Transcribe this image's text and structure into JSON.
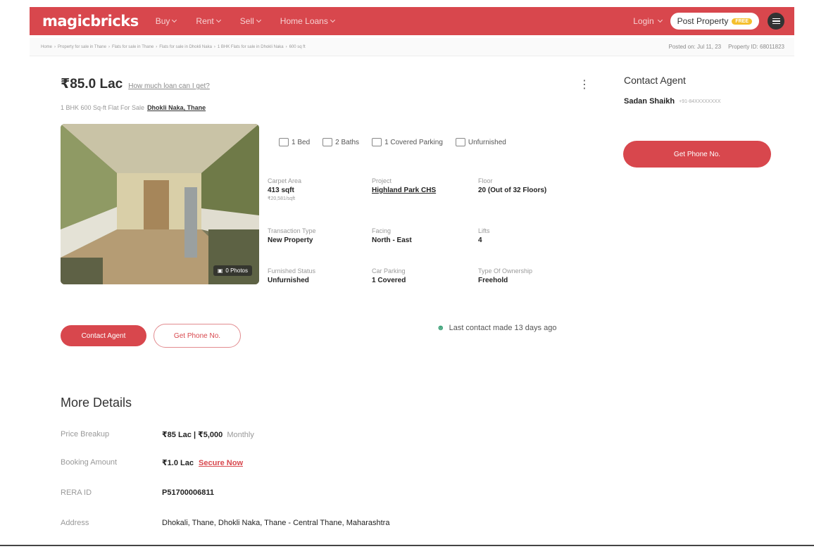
{
  "nav": {
    "logo": "magicbricks",
    "items": [
      {
        "label": "Buy"
      },
      {
        "label": "Rent"
      },
      {
        "label": "Sell"
      },
      {
        "label": "Home Loans"
      }
    ],
    "login": "Login",
    "post_property": "Post Property",
    "free_badge": "FREE"
  },
  "breadcrumb": {
    "items": [
      "Home",
      "Property for sale in Thane",
      "Flats for sale in Thane",
      "Flats for sale in Dhokli Naka",
      "1 BHK Flats for sale in Dhokli Naka",
      "600 sq ft"
    ],
    "posted_on": "Posted on: Jul 11, 23",
    "property_id": "Property ID: 68011823"
  },
  "listing": {
    "price": "₹85.0 Lac",
    "loan_link": "How much loan can I get?",
    "subtitle_prefix": "1 BHK 600 Sq-ft Flat For Sale",
    "location": "Dhokli Naka, Thane",
    "photos_label": "0 Photos",
    "features": [
      {
        "icon": "bed-icon",
        "label": "1 Bed"
      },
      {
        "icon": "bath-icon",
        "label": "2 Baths"
      },
      {
        "icon": "parking-icon",
        "label": "1 Covered Parking"
      },
      {
        "icon": "furnishing-icon",
        "label": "Unfurnished"
      }
    ],
    "specs": {
      "carpet_area": {
        "label": "Carpet Area",
        "value": "413 sqft",
        "sub": "₹20,581/sqft"
      },
      "project": {
        "label": "Project",
        "value": "Highland Park CHS"
      },
      "floor": {
        "label": "Floor",
        "value": "20 (Out of 32 Floors)"
      },
      "transaction_type": {
        "label": "Transaction Type",
        "value": "New Property"
      },
      "facing": {
        "label": "Facing",
        "value": "North - East"
      },
      "lifts": {
        "label": "Lifts",
        "value": "4"
      },
      "furnished_status": {
        "label": "Furnished Status",
        "value": "Unfurnished"
      },
      "car_parking": {
        "label": "Car Parking",
        "value": "1 Covered"
      },
      "ownership": {
        "label": "Type Of Ownership",
        "value": "Freehold"
      }
    },
    "contact_agent_btn": "Contact Agent",
    "get_phone_btn": "Get Phone No.",
    "last_contact": "Last contact made 13 days ago"
  },
  "more_details": {
    "title": "More Details",
    "price_breakup_label": "Price Breakup",
    "price_breakup_value": "₹85 Lac | ₹5,000",
    "price_breakup_suffix": "Monthly",
    "booking_label": "Booking Amount",
    "booking_value": "₹1.0 Lac",
    "secure_now": "Secure Now",
    "rera_label": "RERA ID",
    "rera_value": "P51700006811",
    "address_label": "Address",
    "address_value": "Dhokali, Thane, Dhokli Naka, Thane - Central Thane, Maharashtra"
  },
  "agent": {
    "title": "Contact Agent",
    "name": "Sadan Shaikh",
    "phone": "+91-84XXXXXXXX",
    "get_phone_btn": "Get Phone No."
  },
  "colors": {
    "brand": "#d8474d",
    "free_badge": "#f5c02e"
  }
}
